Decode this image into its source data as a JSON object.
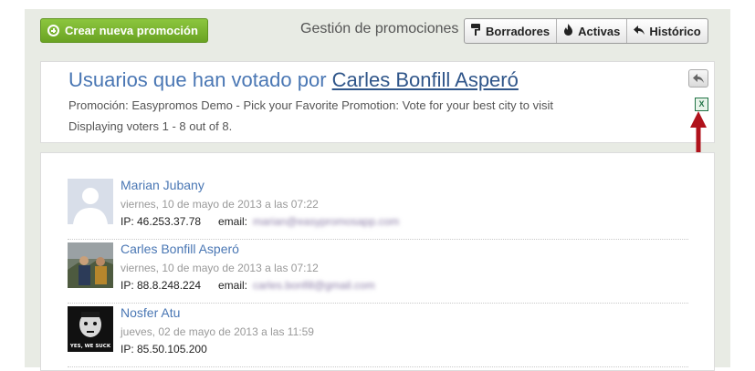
{
  "toolbar": {
    "new_promo_label": "Crear nueva promoción",
    "mgmt_label": "Gestión de promociones",
    "tabs": [
      {
        "label": "Borradores",
        "icon": "paint-roller-icon"
      },
      {
        "label": "Activas",
        "icon": "flame-icon"
      },
      {
        "label": "Histórico",
        "icon": "reply-arrow-icon"
      }
    ],
    "accent_green": "#7bb533"
  },
  "header": {
    "title_prefix": "Usuarios que han votado por ",
    "title_user": "Carles Bonfill Asperó",
    "promo_line": "Promoción: Easypromos Demo - Pick your Favorite Promotion: Vote for your best city to visit",
    "displaying": "Displaying voters 1 - 8 out of 8.",
    "back_icon": "back-arrow-icon",
    "excel_icon": "excel-export-icon",
    "arrow_color": "#b0121b"
  },
  "voters": [
    {
      "name": "Marian Jubany",
      "date": "viernes, 10 de mayo de 2013 a las 07:22",
      "ip": "IP: 46.253.37.78",
      "email_label": "email:",
      "email": "marian@easypromosapp.com"
    },
    {
      "name": "Carles Bonfill Asperó",
      "date": "viernes, 10 de mayo de 2013 a las 07:12",
      "ip": "IP: 88.8.248.224",
      "email_label": "email:",
      "email": "carles.bonfill@gmail.com"
    },
    {
      "name": "Nosfer Atu",
      "date": "jueves, 02 de mayo de 2013 a las 11:59",
      "ip": "IP: 85.50.105.200",
      "avatar_caption": "YES, WE SUCK"
    }
  ]
}
